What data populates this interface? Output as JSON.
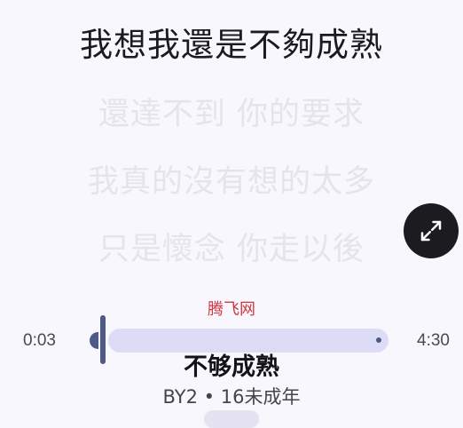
{
  "lyrics": {
    "current": "我想我還是不夠成熟",
    "next": [
      "還達不到 你的要求",
      "我真的沒有想的太多",
      "只是懷念 你走以後"
    ]
  },
  "watermark": "腾飞网",
  "player": {
    "elapsed": "0:03",
    "total": "4:30",
    "progress_fraction": 0.011,
    "expand_icon": "expand-diagonal-icon"
  },
  "song": {
    "title": "不够成熟",
    "artist_album": "BY2 • 16未成年"
  },
  "colors": {
    "background": "#f8f7fd",
    "accent": "#4d5a89",
    "track": "#dcdcf6",
    "button_dark": "#1c1b20"
  }
}
